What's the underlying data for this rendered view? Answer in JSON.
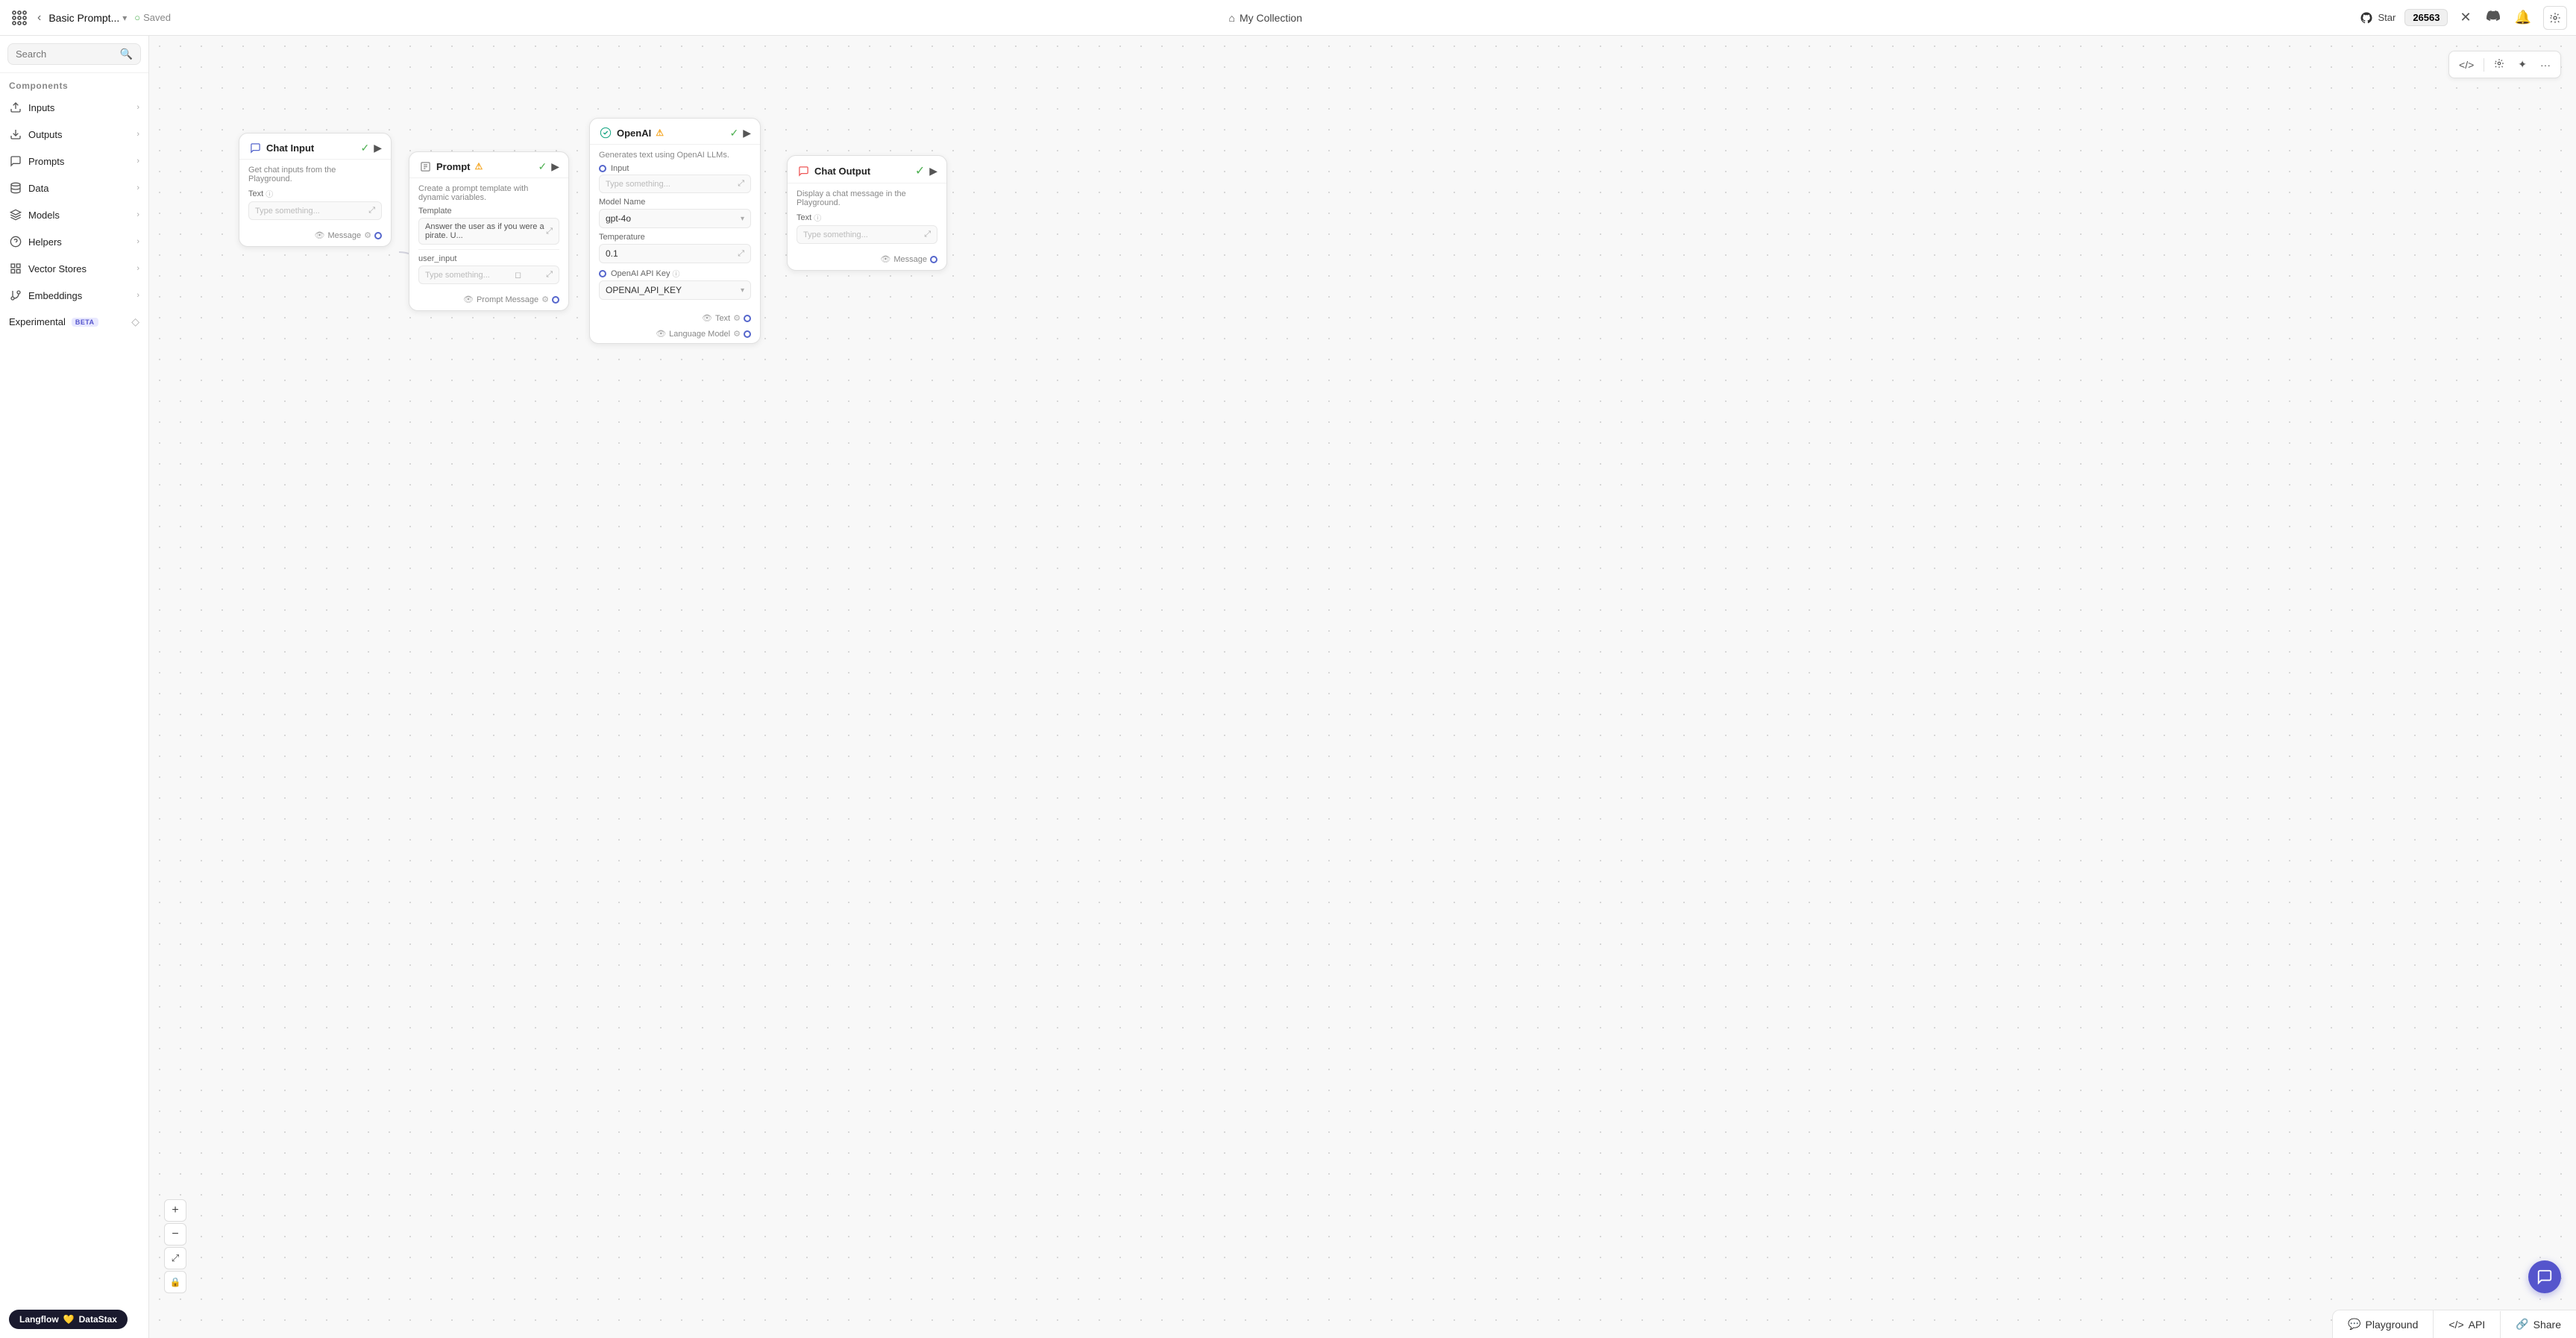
{
  "topbar": {
    "logo_label": "Langflow",
    "project_name": "Basic Prompt...",
    "saved_label": "Saved",
    "collection_label": "My Collection",
    "star_label": "Star",
    "star_count": "26563",
    "back_arrow": "‹",
    "chevron_down": "▾",
    "home_icon": "⌂"
  },
  "sidebar": {
    "search_placeholder": "Search",
    "components_label": "Components",
    "items": [
      {
        "id": "inputs",
        "label": "Inputs"
      },
      {
        "id": "outputs",
        "label": "Outputs"
      },
      {
        "id": "prompts",
        "label": "Prompts"
      },
      {
        "id": "data",
        "label": "Data"
      },
      {
        "id": "models",
        "label": "Models"
      },
      {
        "id": "helpers",
        "label": "Helpers"
      },
      {
        "id": "vector-stores",
        "label": "Vector Stores"
      },
      {
        "id": "embeddings",
        "label": "Embeddings"
      }
    ],
    "experimental_label": "Experimental",
    "beta_label": "BETA"
  },
  "nodes": {
    "chat_input": {
      "title": "Chat Input",
      "description": "Get chat inputs from the Playground.",
      "text_label": "Text",
      "text_placeholder": "Type something...",
      "port_label": "Message",
      "check": "✓"
    },
    "prompt": {
      "title": "Prompt",
      "description": "Create a prompt template with dynamic variables.",
      "template_label": "Template",
      "template_value": "Answer the user as if you were a pirate. U...",
      "user_input_label": "user_input",
      "user_input_placeholder": "Type something...",
      "port_label": "Prompt Message",
      "check": "✓",
      "warning": "⚠"
    },
    "openai": {
      "title": "OpenAI",
      "warning": "⚠",
      "description": "Generates text using OpenAI LLMs.",
      "input_label": "Input",
      "input_placeholder": "Type something...",
      "model_label": "Model Name",
      "model_value": "gpt-4o",
      "temperature_label": "Temperature",
      "temperature_value": "0.1",
      "api_key_label": "OpenAI API Key",
      "api_key_value": "OPENAI_API_KEY",
      "text_port": "Text",
      "language_model_port": "Language Model",
      "check": "✓"
    },
    "chat_output": {
      "title": "Chat Output",
      "description": "Display a chat message in the Playground.",
      "text_label": "Text",
      "text_placeholder": "Type something...",
      "port_label": "Message",
      "check": "✓"
    }
  },
  "canvas_toolbar": {
    "code_icon": "</>",
    "settings_icon": "⚙",
    "magic_icon": "✦",
    "more_icon": "···"
  },
  "zoom_controls": {
    "plus": "+",
    "minus": "−",
    "fullscreen": "⤢",
    "lock": "🔒"
  },
  "bottom_bar": {
    "playground_label": "Playground",
    "api_label": "API",
    "share_label": "Share"
  },
  "langflow_badge": {
    "label": "Langflow",
    "heart": "💛",
    "company": "DataStax"
  }
}
